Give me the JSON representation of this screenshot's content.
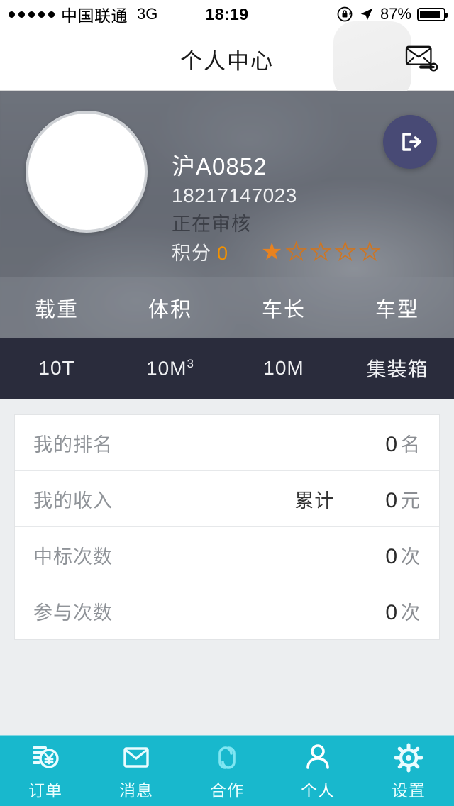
{
  "statusbar": {
    "carrier": "中国联通",
    "network": "3G",
    "time": "18:19",
    "battery_percent": "87%",
    "icons": [
      "signal-dots-icon",
      "rotation-lock-icon",
      "location-arrow-icon",
      "battery-icon"
    ]
  },
  "navbar": {
    "title": "个人中心",
    "right_icon": "envelope-key-icon"
  },
  "profile": {
    "avatar": "avatar-placeholder",
    "plate": "沪A0852",
    "phone": "18217147023",
    "status": "正在审核",
    "score_label": "积分",
    "score_value": "0",
    "rating_filled": 1,
    "rating_total": 5,
    "logout_icon": "logout-arrow-icon",
    "accent_orange": "#f29100",
    "logout_bg": "#484a75"
  },
  "specs": {
    "labels": [
      "载重",
      "体积",
      "车长",
      "车型"
    ],
    "values": [
      "10T",
      "10M³",
      "10M",
      "集装箱"
    ],
    "values_bg": "#2a2c3c"
  },
  "stats": [
    {
      "label": "我的排名",
      "middle": "",
      "value": "0",
      "unit": "名"
    },
    {
      "label": "我的收入",
      "middle": "累计",
      "value": "0",
      "unit": "元"
    },
    {
      "label": "中标次数",
      "middle": "",
      "value": "0",
      "unit": "次"
    },
    {
      "label": "参与次数",
      "middle": "",
      "value": "0",
      "unit": "次"
    }
  ],
  "tabbar": {
    "background": "#18b8cd",
    "items": [
      {
        "label": "订单",
        "icon": "order-receipt-icon",
        "active": false
      },
      {
        "label": "消息",
        "icon": "envelope-icon",
        "active": false
      },
      {
        "label": "合作",
        "icon": "chain-links-icon",
        "active": false
      },
      {
        "label": "个人",
        "icon": "person-icon",
        "active": true
      },
      {
        "label": "设置",
        "icon": "gear-icon",
        "active": false
      }
    ]
  }
}
